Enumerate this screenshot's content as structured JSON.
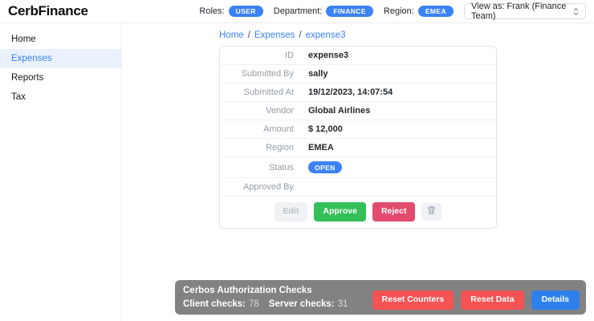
{
  "app": {
    "title": "CerbFinance"
  },
  "header": {
    "roles_label": "Roles:",
    "roles_value": "USER",
    "department_label": "Department:",
    "department_value": "FINANCE",
    "region_label": "Region:",
    "region_value": "EMEA",
    "view_as_value": "View as: Frank (Finance Team)"
  },
  "sidebar": {
    "active_item": "Expenses",
    "items": [
      {
        "label": "Home"
      },
      {
        "label": "Expenses"
      },
      {
        "label": "Reports"
      },
      {
        "label": "Tax"
      }
    ]
  },
  "breadcrumb": {
    "separator": "/",
    "items": [
      "Home",
      "Expenses",
      "expense3"
    ]
  },
  "expense_detail": {
    "rows": [
      {
        "label": "ID",
        "value": "expense3"
      },
      {
        "label": "Submitted By",
        "value": "sally"
      },
      {
        "label": "Submitted At",
        "value": "19/12/2023, 14:07:54"
      },
      {
        "label": "Vendor",
        "value": "Global Airlines"
      },
      {
        "label": "Amount",
        "value": "$ 12,000"
      },
      {
        "label": "Region",
        "value": "EMEA"
      },
      {
        "label": "Status",
        "value": "OPEN"
      },
      {
        "label": "Approved By",
        "value": ""
      }
    ],
    "actions": {
      "edit": "Edit",
      "approve": "Approve",
      "reject": "Reject",
      "delete_icon": "trash-icon"
    }
  },
  "authz_panel": {
    "title": "Cerbos Authorization Checks",
    "client_checks_label": "Client checks:",
    "client_checks_value": "78",
    "server_checks_label": "Server checks:",
    "server_checks_value": "31",
    "reset_counters_label": "Reset Counters",
    "reset_data_label": "Reset Data",
    "details_label": "Details"
  },
  "colors": {
    "accent_blue": "#3b82f6",
    "approve_green": "#34c057",
    "reject_red": "#e34b6e",
    "reset_red": "#f45454",
    "details_blue": "#2f80ed",
    "panel_gray": "#828282",
    "active_nav_bg": "#e9f1fd"
  }
}
